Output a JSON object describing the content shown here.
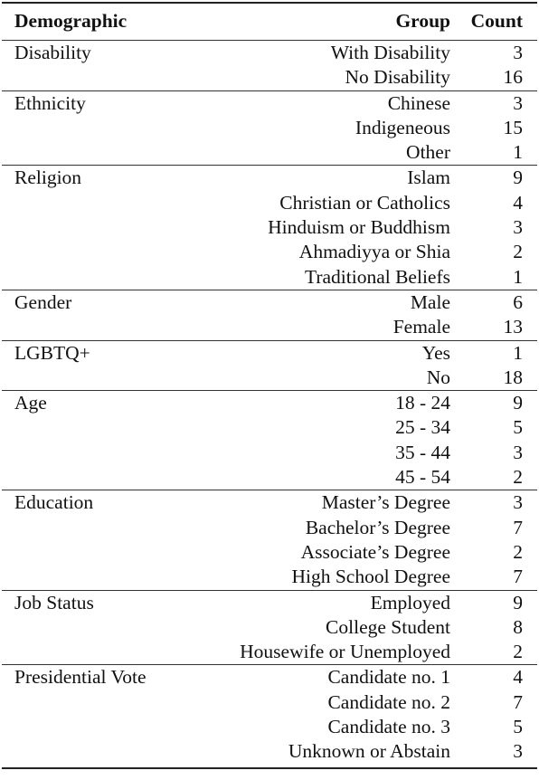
{
  "table": {
    "headers": {
      "demographic": "Demographic",
      "group": "Group",
      "count": "Count"
    },
    "sections": [
      {
        "demographic": "Disability",
        "rows": [
          {
            "group": "With Disability",
            "count": "3"
          },
          {
            "group": "No Disability",
            "count": "16"
          }
        ]
      },
      {
        "demographic": "Ethnicity",
        "rows": [
          {
            "group": "Chinese",
            "count": "3"
          },
          {
            "group": "Indigeneous",
            "count": "15"
          },
          {
            "group": "Other",
            "count": "1"
          }
        ]
      },
      {
        "demographic": "Religion",
        "rows": [
          {
            "group": "Islam",
            "count": "9"
          },
          {
            "group": "Christian or Catholics",
            "count": "4"
          },
          {
            "group": "Hinduism or Buddhism",
            "count": "3"
          },
          {
            "group": "Ahmadiyya or Shia",
            "count": "2"
          },
          {
            "group": "Traditional Beliefs",
            "count": "1"
          }
        ]
      },
      {
        "demographic": "Gender",
        "rows": [
          {
            "group": "Male",
            "count": "6"
          },
          {
            "group": "Female",
            "count": "13"
          }
        ]
      },
      {
        "demographic": "LGBTQ+",
        "rows": [
          {
            "group": "Yes",
            "count": "1"
          },
          {
            "group": "No",
            "count": "18"
          }
        ]
      },
      {
        "demographic": "Age",
        "rows": [
          {
            "group": "18 - 24",
            "count": "9"
          },
          {
            "group": "25 - 34",
            "count": "5"
          },
          {
            "group": "35 - 44",
            "count": "3"
          },
          {
            "group": "45 - 54",
            "count": "2"
          }
        ]
      },
      {
        "demographic": "Education",
        "rows": [
          {
            "group": "Master’s Degree",
            "count": "3"
          },
          {
            "group": "Bachelor’s Degree",
            "count": "7"
          },
          {
            "group": "Associate’s Degree",
            "count": "2"
          },
          {
            "group": "High School Degree",
            "count": "7"
          }
        ]
      },
      {
        "demographic": "Job Status",
        "rows": [
          {
            "group": "Employed",
            "count": "9"
          },
          {
            "group": "College Student",
            "count": "8"
          },
          {
            "group": "Housewife or Unemployed",
            "count": "2"
          }
        ]
      },
      {
        "demographic": "Presidential Vote",
        "rows": [
          {
            "group": "Candidate no. 1",
            "count": "4"
          },
          {
            "group": "Candidate no. 2",
            "count": "7"
          },
          {
            "group": "Candidate no. 3",
            "count": "5"
          },
          {
            "group": "Unknown or Abstain",
            "count": "3"
          }
        ]
      }
    ]
  }
}
